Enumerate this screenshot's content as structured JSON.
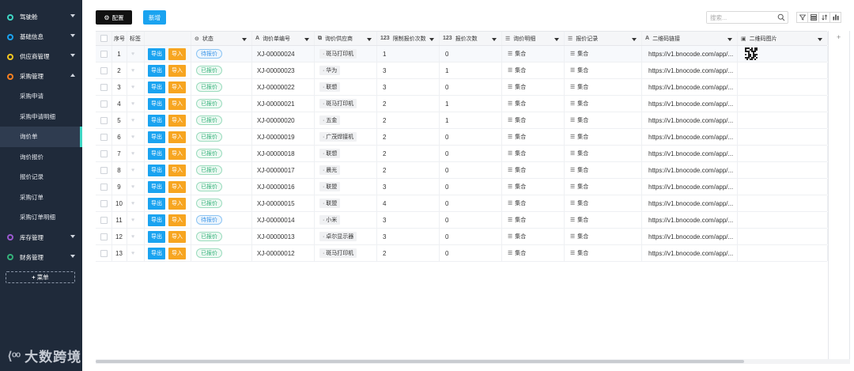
{
  "sidebar": {
    "items": [
      {
        "label": "驾驶舱",
        "color": "#3ed6c4",
        "chevron": "down"
      },
      {
        "label": "基础信息",
        "color": "#1aa3f0",
        "chevron": "down"
      },
      {
        "label": "供应商管理",
        "color": "#f7c520",
        "chevron": "down"
      },
      {
        "label": "采购管理",
        "color": "#f77f20",
        "chevron": "up"
      }
    ],
    "sub_items": [
      "采购申请",
      "采购申请明细",
      "询价单",
      "询价报价",
      "报价记录",
      "采购订单",
      "采购订单明细"
    ],
    "active_sub": 2,
    "bottom_items": [
      {
        "label": "库存管理",
        "color": "#9b59d0",
        "chevron": "down"
      },
      {
        "label": "财务管理",
        "color": "#34b27a",
        "chevron": "down"
      }
    ],
    "add_menu_label": "菜单",
    "brand_text": "大数跨境"
  },
  "toolbar": {
    "config_label": "配置",
    "new_label": "新增",
    "search_placeholder": "搜索..."
  },
  "table": {
    "columns": {
      "index": "序号",
      "tag": "标签",
      "status": "状态",
      "code": "询价单编号",
      "vendor": "询价供应商",
      "limit_count": "限制报价次数",
      "quote_count": "报价次数",
      "detail": "询价明细",
      "record": "报价记录",
      "qr_link": "二维码链接",
      "qr_image": "二维码图片"
    },
    "number_prefix": "123",
    "action_export": "导出",
    "action_import": "导入",
    "set_label": "集合",
    "rows": [
      {
        "no": "1",
        "status": "待报价",
        "status_type": "pending",
        "code": "XJ-00000024",
        "vendor": "斑马打印机",
        "limit": "1",
        "count": "0",
        "link": "https://v1.bnocode.com/app/...",
        "qr": true
      },
      {
        "no": "2",
        "status": "已报价",
        "status_type": "done",
        "code": "XJ-00000023",
        "vendor": "华为",
        "limit": "3",
        "count": "1",
        "link": "https://v1.bnocode.com/app/...",
        "qr": false
      },
      {
        "no": "3",
        "status": "已报价",
        "status_type": "done",
        "code": "XJ-00000022",
        "vendor": "联想",
        "limit": "3",
        "count": "0",
        "link": "https://v1.bnocode.com/app/...",
        "qr": false
      },
      {
        "no": "4",
        "status": "已报价",
        "status_type": "done",
        "code": "XJ-00000021",
        "vendor": "斑马打印机",
        "limit": "2",
        "count": "1",
        "link": "https://v1.bnocode.com/app/...",
        "qr": false
      },
      {
        "no": "5",
        "status": "已报价",
        "status_type": "done",
        "code": "XJ-00000020",
        "vendor": "五金",
        "limit": "2",
        "count": "1",
        "link": "https://v1.bnocode.com/app/...",
        "qr": false
      },
      {
        "no": "6",
        "status": "已报价",
        "status_type": "done",
        "code": "XJ-00000019",
        "vendor": "广茂焊接机",
        "limit": "2",
        "count": "0",
        "link": "https://v1.bnocode.com/app/...",
        "qr": false
      },
      {
        "no": "7",
        "status": "已报价",
        "status_type": "done",
        "code": "XJ-00000018",
        "vendor": "联想",
        "limit": "2",
        "count": "0",
        "link": "https://v1.bnocode.com/app/...",
        "qr": false
      },
      {
        "no": "8",
        "status": "已报价",
        "status_type": "done",
        "code": "XJ-00000017",
        "vendor": "晨光",
        "limit": "2",
        "count": "0",
        "link": "https://v1.bnocode.com/app/...",
        "qr": false
      },
      {
        "no": "9",
        "status": "已报价",
        "status_type": "done",
        "code": "XJ-00000016",
        "vendor": "联盟",
        "limit": "3",
        "count": "0",
        "link": "https://v1.bnocode.com/app/...",
        "qr": false
      },
      {
        "no": "10",
        "status": "已报价",
        "status_type": "done",
        "code": "XJ-00000015",
        "vendor": "联盟",
        "limit": "4",
        "count": "0",
        "link": "https://v1.bnocode.com/app/...",
        "qr": false
      },
      {
        "no": "11",
        "status": "待报价",
        "status_type": "pending",
        "code": "XJ-00000014",
        "vendor": "小米",
        "limit": "3",
        "count": "0",
        "link": "https://v1.bnocode.com/app/...",
        "qr": false
      },
      {
        "no": "12",
        "status": "已报价",
        "status_type": "done",
        "code": "XJ-00000013",
        "vendor": "卓尔显示器",
        "limit": "3",
        "count": "0",
        "link": "https://v1.bnocode.com/app/...",
        "qr": false
      },
      {
        "no": "13",
        "status": "已报价",
        "status_type": "done",
        "code": "XJ-00000012",
        "vendor": "斑马打印机",
        "limit": "2",
        "count": "0",
        "link": "https://v1.bnocode.com/app/...",
        "qr": false
      }
    ]
  }
}
